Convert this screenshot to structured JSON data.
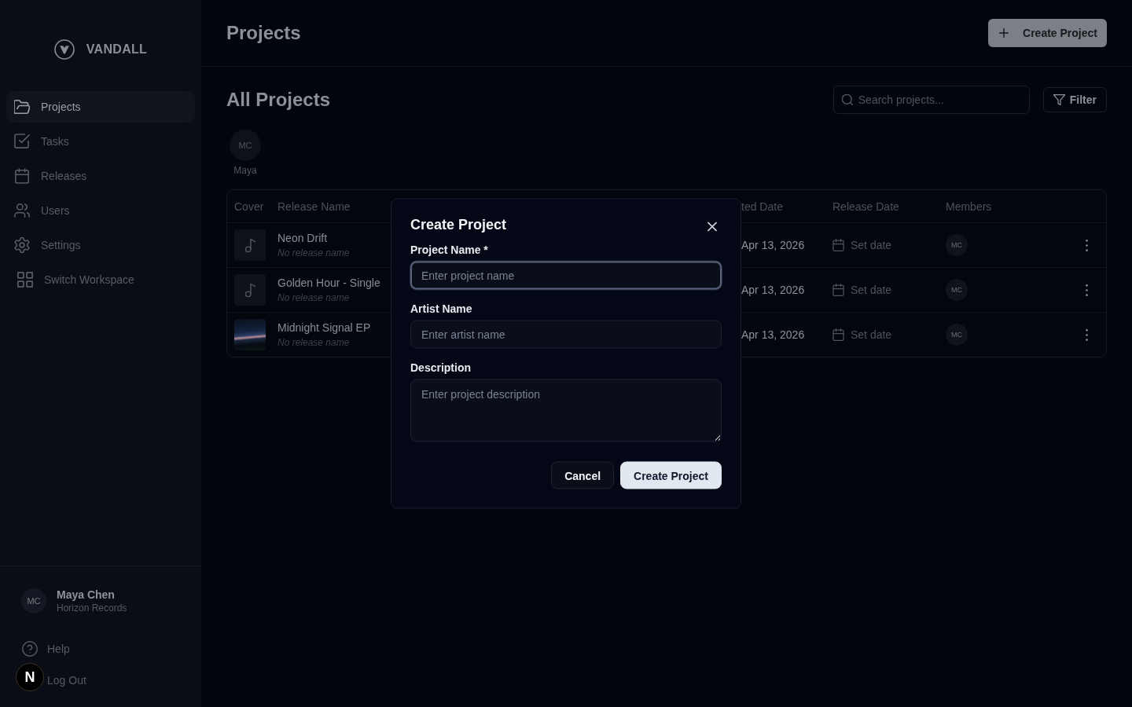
{
  "sidebar": {
    "brand": "VANDALL",
    "nav": [
      {
        "label": "Projects",
        "kind": "folder",
        "selected": true
      },
      {
        "label": "Tasks",
        "kind": "tasks",
        "selected": false
      },
      {
        "label": "Releases",
        "kind": "calendar",
        "selected": false
      },
      {
        "label": "Users",
        "kind": "users",
        "selected": false
      },
      {
        "label": "Settings",
        "kind": "settings",
        "selected": false
      },
      {
        "label": "Switch Workspace",
        "kind": "workspace",
        "selected": false
      }
    ],
    "user": {
      "initials": "MC",
      "name": "Maya Chen",
      "organization": "Horizon Records"
    },
    "links": [
      {
        "label": "Help",
        "kind": "help"
      },
      {
        "label": "Log Out",
        "kind": "logout"
      }
    ]
  },
  "header": {
    "title": "Projects",
    "action": "Create Project"
  },
  "toolbar": {
    "title": "All Projects",
    "search": {
      "placeholder": "Search projects..."
    },
    "filter": "Filter"
  },
  "member_filters": [
    {
      "initials": "MC",
      "name": "Maya"
    }
  ],
  "table": {
    "columns": [
      "Cover",
      "Release Name",
      "ted Date",
      "Release Date",
      "Members"
    ],
    "rows": [
      {
        "kind": "placeholder",
        "title": "Neon Drift",
        "subtitle": "No release name",
        "created": "Apr 13, 2026",
        "release_date": "Set date",
        "members": [
          "MC"
        ]
      },
      {
        "kind": "placeholder",
        "title": "Golden Hour - Single",
        "subtitle": "No release name",
        "created": "Apr 13, 2026",
        "release_date": "Set date",
        "members": [
          "MC"
        ]
      },
      {
        "kind": "photo",
        "title": "Midnight Signal EP",
        "subtitle": "No release name",
        "created": "Apr 13, 2026",
        "release_date": "Set date",
        "members": [
          "MC"
        ]
      }
    ]
  },
  "dialog": {
    "title": "Create Project",
    "fields": [
      {
        "label": "Project Name *",
        "placeholder": "Enter project name",
        "kind": "input",
        "focused": true
      },
      {
        "label": "Artist Name",
        "placeholder": "Enter artist name",
        "kind": "input",
        "focused": false
      },
      {
        "label": "Description",
        "placeholder": "Enter project description",
        "kind": "textarea",
        "focused": false
      }
    ],
    "buttons": [
      {
        "label": "Cancel",
        "kind": "secondary"
      },
      {
        "label": "Create Project",
        "kind": "primary"
      }
    ]
  },
  "dev_badge": "N"
}
